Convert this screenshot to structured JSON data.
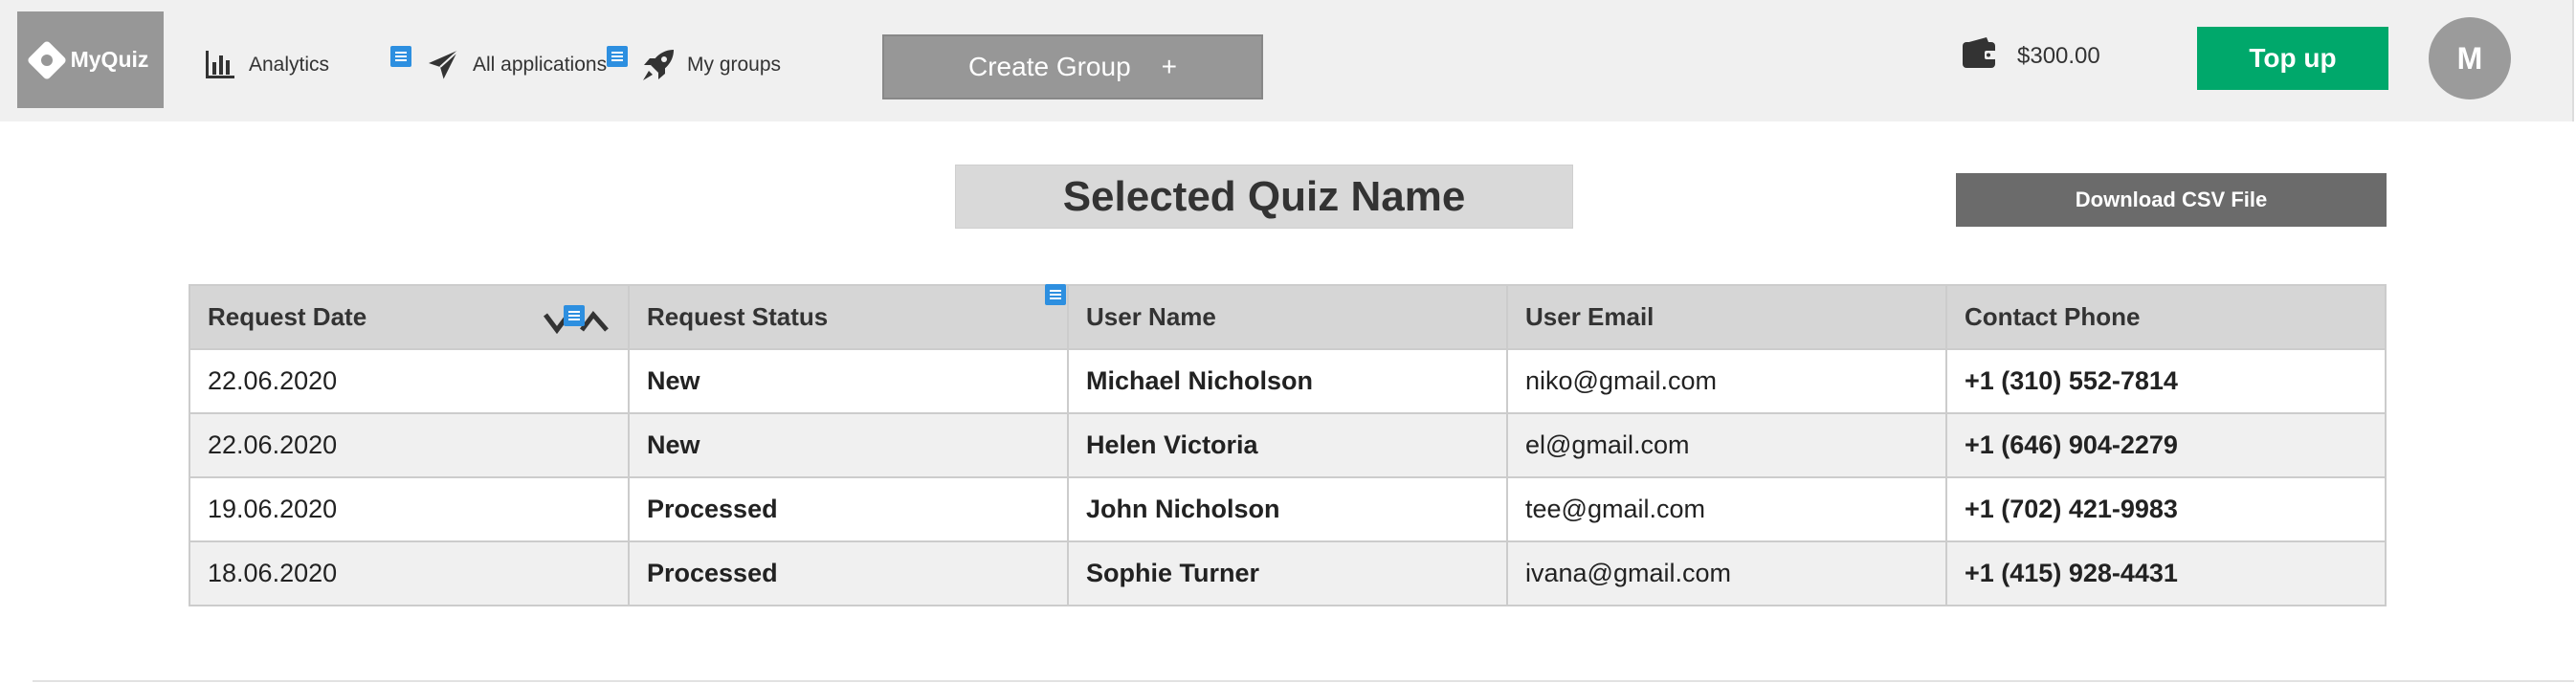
{
  "header": {
    "logo_text": "MyQuiz",
    "nav": [
      {
        "label": "Analytics",
        "icon": "bar-chart-icon"
      },
      {
        "label": "All applications",
        "icon": "paper-plane-icon"
      },
      {
        "label": "My groups",
        "icon": "rocket-icon"
      }
    ],
    "create_group_label": "Create Group",
    "create_group_plus": "+",
    "balance": "$300.00",
    "topup_label": "Top up",
    "avatar_initial": "M"
  },
  "main": {
    "quiz_title": "Selected Quiz Name",
    "download_label": "Download CSV File"
  },
  "table": {
    "columns": [
      "Request Date",
      "Request Status",
      "User Name",
      "User Email",
      "Contact Phone"
    ],
    "rows": [
      {
        "date": "22.06.2020",
        "status": "New",
        "name": "Michael Nicholson",
        "email": "niko@gmail.com",
        "phone": "+1 (310) 552-7814"
      },
      {
        "date": "22.06.2020",
        "status": "New",
        "name": "Helen Victoria",
        "email": "el@gmail.com",
        "phone": "+1 (646) 904-2279"
      },
      {
        "date": "19.06.2020",
        "status": "Processed",
        "name": "John Nicholson",
        "email": "tee@gmail.com",
        "phone": "+1 (702) 421-9983"
      },
      {
        "date": "18.06.2020",
        "status": "Processed",
        "name": "Sophie Turner",
        "email": "ivana@gmail.com",
        "phone": "+1 (415) 928-4431"
      }
    ]
  },
  "colors": {
    "status_new": "#e53935",
    "status_processed": "#0a0a9a",
    "topup": "#00a86b",
    "note_marker": "#2d8fe0"
  }
}
